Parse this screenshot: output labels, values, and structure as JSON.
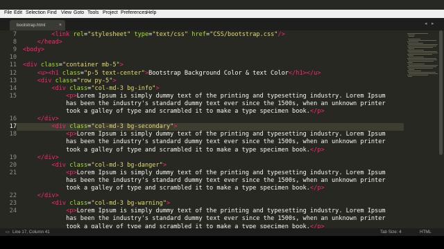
{
  "menu": [
    "File",
    "Edit",
    "Selection",
    "Find",
    "View",
    "Goto",
    "Tools",
    "Project",
    "Preferences",
    "Help"
  ],
  "tab": {
    "label": "bootstrap.html",
    "close": "×"
  },
  "status": {
    "position": "Line 17, Column 41",
    "tab_size": "Tab Size: 4",
    "syntax": "HTML"
  },
  "lines": [
    {
      "n": "7",
      "seg": [
        [
          "tx",
          "        "
        ],
        [
          "tg",
          "<link "
        ],
        [
          "at",
          "rel"
        ],
        [
          "tx",
          "="
        ],
        [
          "st",
          "\"stylesheet\""
        ],
        [
          "tx",
          " "
        ],
        [
          "at",
          "type"
        ],
        [
          "tx",
          "="
        ],
        [
          "st",
          "\"text/css\""
        ],
        [
          "tx",
          " "
        ],
        [
          "at",
          "href"
        ],
        [
          "tx",
          "="
        ],
        [
          "st",
          "\"CSS/bootstrap.css\""
        ],
        [
          "tg",
          "/>"
        ]
      ]
    },
    {
      "n": "8",
      "seg": [
        [
          "tx",
          "    "
        ],
        [
          "tg",
          "</head>"
        ]
      ]
    },
    {
      "n": "9",
      "seg": [
        [
          "tg",
          "<body>"
        ]
      ]
    },
    {
      "n": "10",
      "seg": []
    },
    {
      "n": "11",
      "seg": [
        [
          "tg",
          "<div "
        ],
        [
          "at",
          "class"
        ],
        [
          "tx",
          "="
        ],
        [
          "st",
          "\"container mb-5\""
        ],
        [
          "tg",
          ">"
        ]
      ]
    },
    {
      "n": "12",
      "seg": [
        [
          "tx",
          "    "
        ],
        [
          "tg",
          "<u><h1 "
        ],
        [
          "at",
          "class"
        ],
        [
          "tx",
          "="
        ],
        [
          "st",
          "\"p-5 text-center\""
        ],
        [
          "tg",
          ">"
        ],
        [
          "tx",
          "Bootstrap Background Color & text Color"
        ],
        [
          "tg",
          "</h1></u>"
        ]
      ]
    },
    {
      "n": "13",
      "seg": [
        [
          "tx",
          "    "
        ],
        [
          "tg",
          "<div "
        ],
        [
          "at",
          "class"
        ],
        [
          "tx",
          "="
        ],
        [
          "st",
          "\"row py-5\""
        ],
        [
          "tg",
          ">"
        ]
      ]
    },
    {
      "n": "14",
      "seg": [
        [
          "tx",
          "        "
        ],
        [
          "tg",
          "<div "
        ],
        [
          "at",
          "class"
        ],
        [
          "tx",
          "="
        ],
        [
          "st",
          "\"col-md-3 bg-info\""
        ],
        [
          "tg",
          ">"
        ]
      ]
    },
    {
      "n": "15",
      "seg": [
        [
          "tx",
          "            "
        ],
        [
          "tg",
          "<p>"
        ],
        [
          "tx",
          "Lorem Ipsum is simply dummy text of the printing and typesetting industry. Lorem Ipsum"
        ]
      ]
    },
    {
      "n": "",
      "seg": [
        [
          "tx",
          "            has been the industry's standard dummy text ever since the 1500s, when an unknown printer"
        ]
      ]
    },
    {
      "n": "",
      "seg": [
        [
          "tx",
          "            took a galley of type and scrambled it to make a type specimen book."
        ],
        [
          "tg",
          "</p>"
        ]
      ]
    },
    {
      "n": "16",
      "seg": [
        [
          "tx",
          "    "
        ],
        [
          "tg",
          "</div>"
        ]
      ]
    },
    {
      "n": "17",
      "active": true,
      "seg": [
        [
          "tx",
          "        "
        ],
        [
          "tg",
          "<div "
        ],
        [
          "at",
          "class"
        ],
        [
          "tx",
          "="
        ],
        [
          "st",
          "\"col-md-3 bg-secondary\""
        ],
        [
          "tg",
          ">"
        ]
      ]
    },
    {
      "n": "18",
      "seg": [
        [
          "tx",
          "            "
        ],
        [
          "tg",
          "<p>"
        ],
        [
          "tx",
          "Lorem Ipsum is simply dummy text of the printing and typesetting industry. Lorem Ipsum"
        ]
      ]
    },
    {
      "n": "",
      "seg": [
        [
          "tx",
          "            has been the industry's standard dummy text ever since the 1500s, when an unknown printer"
        ]
      ]
    },
    {
      "n": "",
      "seg": [
        [
          "tx",
          "            took a galley of type and scrambled it to make a type specimen book."
        ],
        [
          "tg",
          "</p>"
        ]
      ]
    },
    {
      "n": "19",
      "seg": [
        [
          "tx",
          "    "
        ],
        [
          "tg",
          "</div>"
        ]
      ]
    },
    {
      "n": "20",
      "seg": [
        [
          "tx",
          "        "
        ],
        [
          "tg",
          "<div "
        ],
        [
          "at",
          "class"
        ],
        [
          "tx",
          "="
        ],
        [
          "st",
          "\"col-md-3 bg-danger\""
        ],
        [
          "tg",
          ">"
        ]
      ]
    },
    {
      "n": "21",
      "seg": [
        [
          "tx",
          "            "
        ],
        [
          "tg",
          "<p>"
        ],
        [
          "tx",
          "Lorem Ipsum is simply dummy text of the printing and typesetting industry. Lorem Ipsum"
        ]
      ]
    },
    {
      "n": "",
      "seg": [
        [
          "tx",
          "            has been the industry's standard dummy text ever since the 1500s, when an unknown printer"
        ]
      ]
    },
    {
      "n": "",
      "seg": [
        [
          "tx",
          "            took a galley of type and scrambled it to make a type specimen book."
        ],
        [
          "tg",
          "</p>"
        ]
      ]
    },
    {
      "n": "22",
      "seg": [
        [
          "tx",
          "    "
        ],
        [
          "tg",
          "</div>"
        ]
      ]
    },
    {
      "n": "23",
      "seg": [
        [
          "tx",
          "        "
        ],
        [
          "tg",
          "<div "
        ],
        [
          "at",
          "class"
        ],
        [
          "tx",
          "="
        ],
        [
          "st",
          "\"col-md-3 bg-warning\""
        ],
        [
          "tg",
          ">"
        ]
      ]
    },
    {
      "n": "24",
      "seg": [
        [
          "tx",
          "            "
        ],
        [
          "tg",
          "<p>"
        ],
        [
          "tx",
          "Lorem Ipsum is simply dummy text of the printing and typesetting industry. Lorem Ipsum"
        ]
      ]
    },
    {
      "n": "",
      "seg": [
        [
          "tx",
          "            has been the industry's standard dummy text ever since the 1500s, when an unknown printer"
        ]
      ]
    },
    {
      "n": "",
      "seg": [
        [
          "tx",
          "            took a galley of type and scrambled it to make a type specimen book."
        ],
        [
          "tg",
          "</p>"
        ]
      ]
    }
  ]
}
